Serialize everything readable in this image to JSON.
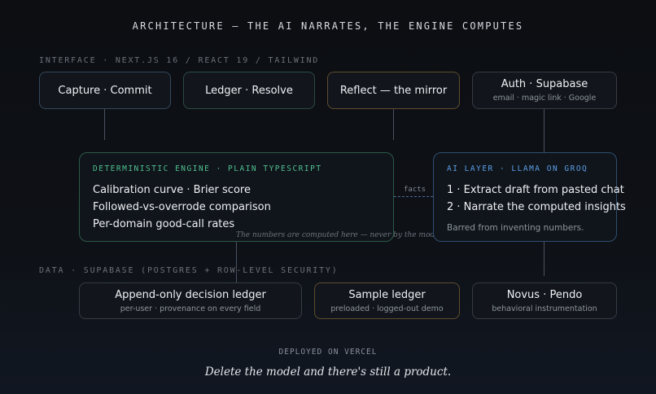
{
  "title": "ARCHITECTURE — THE AI NARRATES, THE ENGINE COMPUTES",
  "interface": {
    "label": "INTERFACE · NEXT.JS 16 / REACT 19 / TAILWIND",
    "boxes": [
      {
        "title": "Capture · Commit"
      },
      {
        "title": "Ledger · Resolve"
      },
      {
        "title": "Reflect — the mirror"
      },
      {
        "title": "Auth · Supabase",
        "subtitle": "email · magic link · Google"
      }
    ]
  },
  "engine": {
    "heading": "DETERMINISTIC ENGINE · PLAIN TYPESCRIPT",
    "items": [
      "Calibration curve · Brier score",
      "Followed-vs-overrode comparison",
      "Per-domain good-call rates"
    ],
    "note": "The numbers are computed here — never by the model."
  },
  "connector": {
    "label": "facts"
  },
  "ai_layer": {
    "heading": "AI LAYER · LLAMA ON GROQ",
    "items": [
      "1 · Extract draft from pasted chat",
      "2 · Narrate the computed insights"
    ],
    "note": "Barred from inventing numbers."
  },
  "data": {
    "label": "DATA · SUPABASE (POSTGRES + ROW-LEVEL SECURITY)",
    "boxes": [
      {
        "title": "Append-only decision ledger",
        "subtitle": "per-user · provenance on every field"
      },
      {
        "title": "Sample ledger",
        "subtitle": "preloaded · logged-out demo"
      },
      {
        "title": "Novus · Pendo",
        "subtitle": "behavioral instrumentation"
      }
    ]
  },
  "footer": {
    "deploy": "DEPLOYED ON VERCEL",
    "tagline": "Delete the model and there's still a product."
  }
}
